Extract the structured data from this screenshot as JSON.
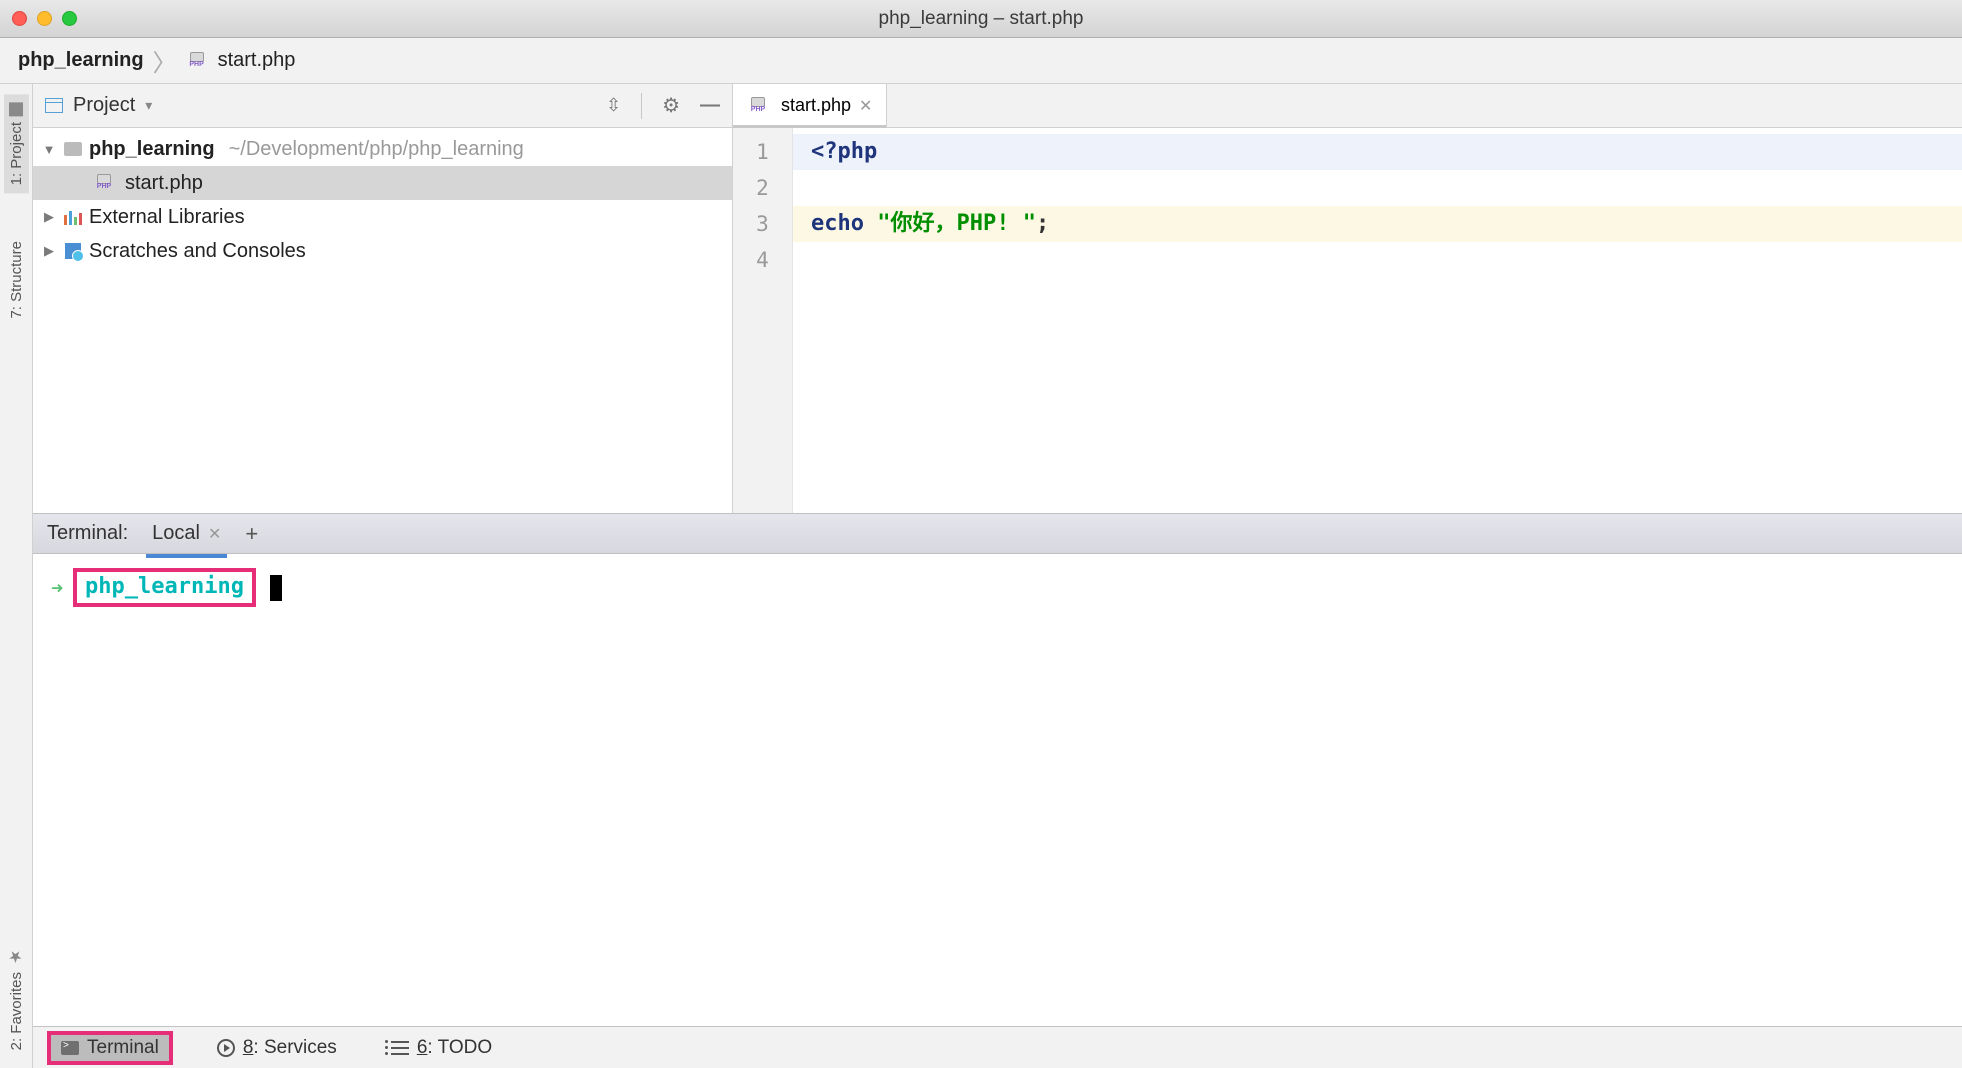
{
  "title_bar": {
    "title": "php_learning – start.php"
  },
  "breadcrumb": {
    "project": "php_learning",
    "file": "start.php"
  },
  "left_rail": {
    "project": "1: Project",
    "structure": "7: Structure",
    "favorites": "2: Favorites"
  },
  "project_panel": {
    "header": "Project",
    "root_name": "php_learning",
    "root_path": "~/Development/php/php_learning",
    "file1": "start.php",
    "ext_lib": "External Libraries",
    "scratches": "Scratches and Consoles"
  },
  "editor": {
    "tab_label": "start.php",
    "gutter": [
      "1",
      "2",
      "3",
      "4"
    ],
    "code": {
      "line1_open": "<?php",
      "line3_echo": "echo ",
      "line3_str": "\"你好，PHP! \"",
      "line3_semi": ";"
    }
  },
  "terminal": {
    "title": "Terminal:",
    "tab": "Local",
    "cwd": "php_learning"
  },
  "bottom_bar": {
    "terminal": "Terminal",
    "services_u": "8",
    "services_rest": ": Services",
    "todo_u": "6",
    "todo_rest": ": TODO"
  }
}
